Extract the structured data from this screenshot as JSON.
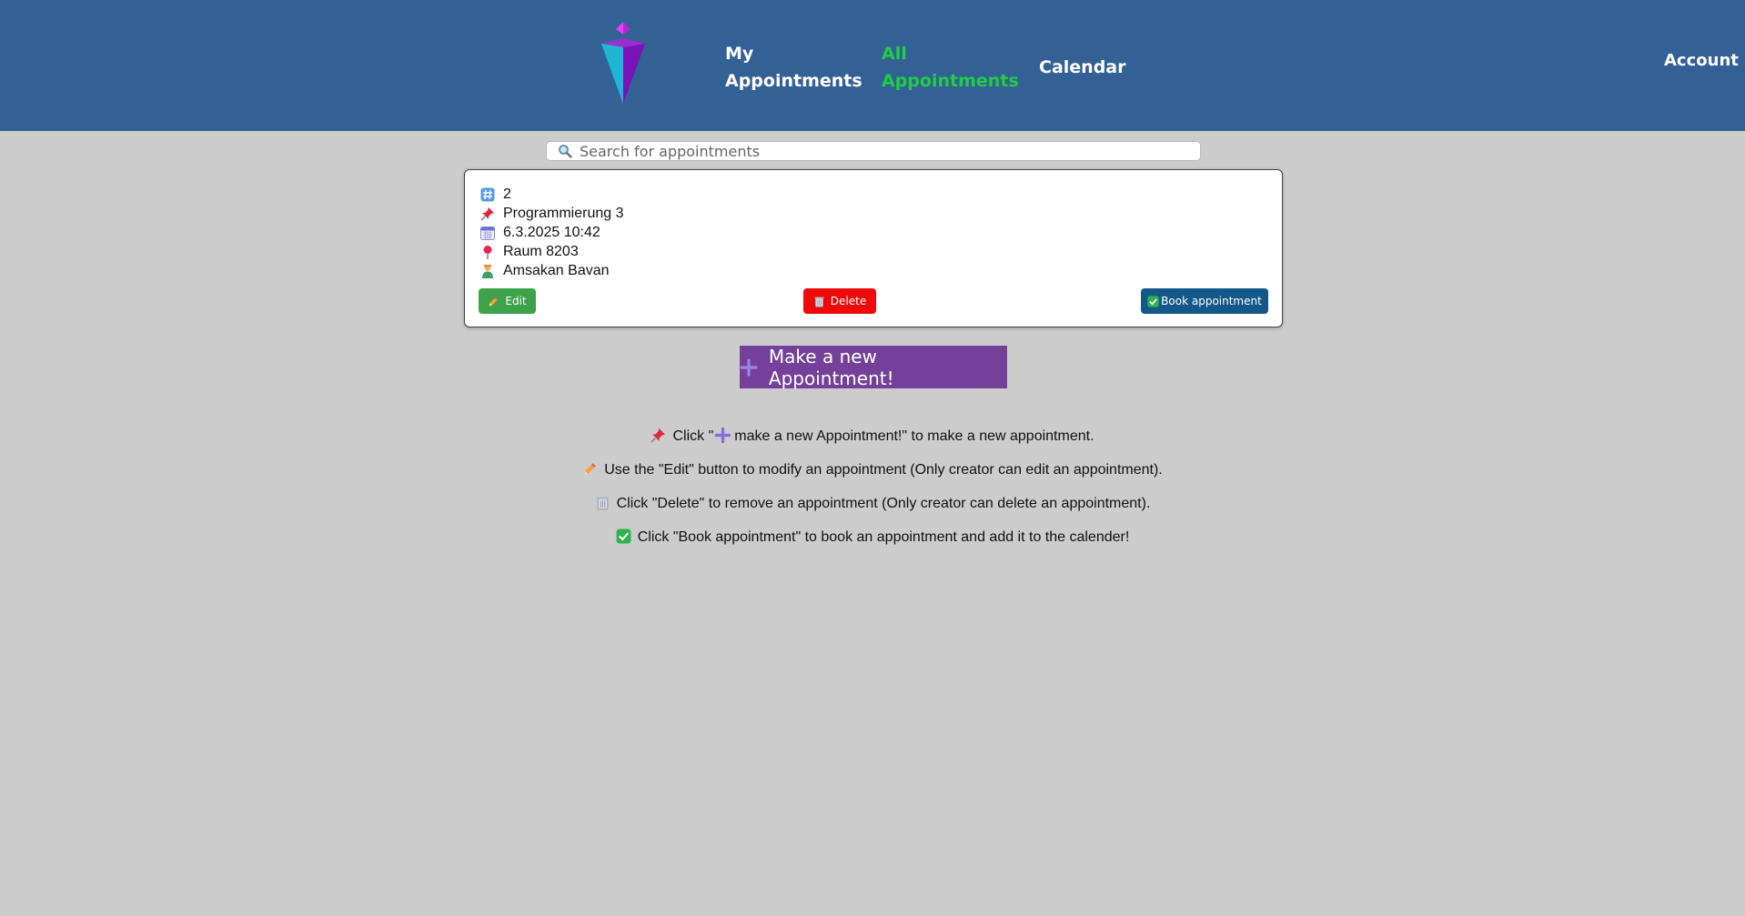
{
  "header": {
    "logo_icon": "crystal-logo-icon",
    "nav": {
      "my_appointments_line1": "My",
      "my_appointments_line2": "Appointments",
      "all_appointments_line1": "All",
      "all_appointments_line2": "Appointments",
      "calendar": "Calendar",
      "account": "Account"
    },
    "active_color": "#22cc44",
    "background_color": "#336195"
  },
  "search": {
    "placeholder": "Search for appointments",
    "icon": "search-icon"
  },
  "appointment": {
    "id": "2",
    "title": "Programmierung 3",
    "datetime": "6.3.2025 10:42",
    "location": "Raum 8203",
    "creator": "Amsakan Bavan",
    "buttons": {
      "edit": "Edit",
      "delete": "Delete",
      "book": "Book appointment"
    }
  },
  "new_appointment_button": "Make a new Appointment!",
  "instructions": {
    "line1_pre": "Click \"",
    "line1_post": "make a new Appointment!\" to make a new appointment.",
    "line2": "Use the \"Edit\" button to modify an appointment (Only creator can edit an appointment).",
    "line3": "Click \"Delete\" to remove an appointment (Only creator can delete an appointment).",
    "line4": "Click \"Book appointment\" to book an appointment and add it to the calender!"
  },
  "colors": {
    "edit": "#3ea24a",
    "delete": "#ee0a0a",
    "book": "#14588a",
    "new_button": "#74409a",
    "page_background": "#cccccc"
  }
}
